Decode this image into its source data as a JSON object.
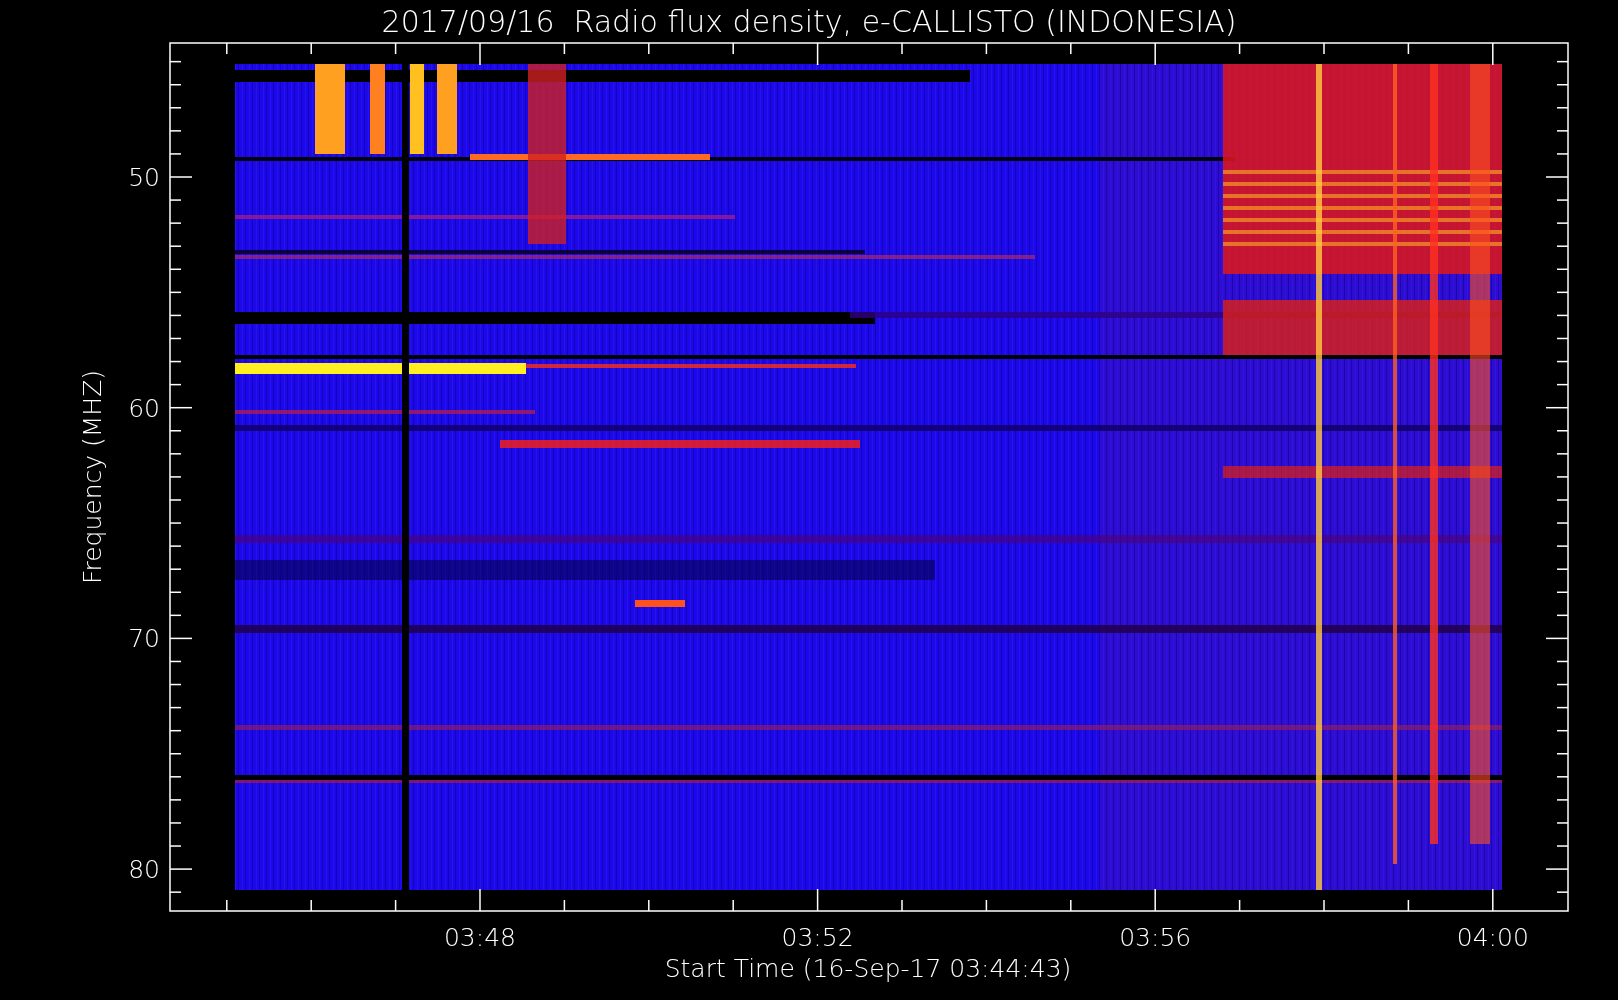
{
  "title": "2017/09/16  Radio flux density, e-CALLISTO (INDONESIA)",
  "y_axis": {
    "label": "Frequency (MHZ)",
    "ticks": [
      "50",
      "60",
      "70",
      "80"
    ]
  },
  "x_axis": {
    "label": "Start Time (16-Sep-17 03:44:43)",
    "ticks": [
      "03:48",
      "03:52",
      "03:56",
      "04:00"
    ]
  }
}
